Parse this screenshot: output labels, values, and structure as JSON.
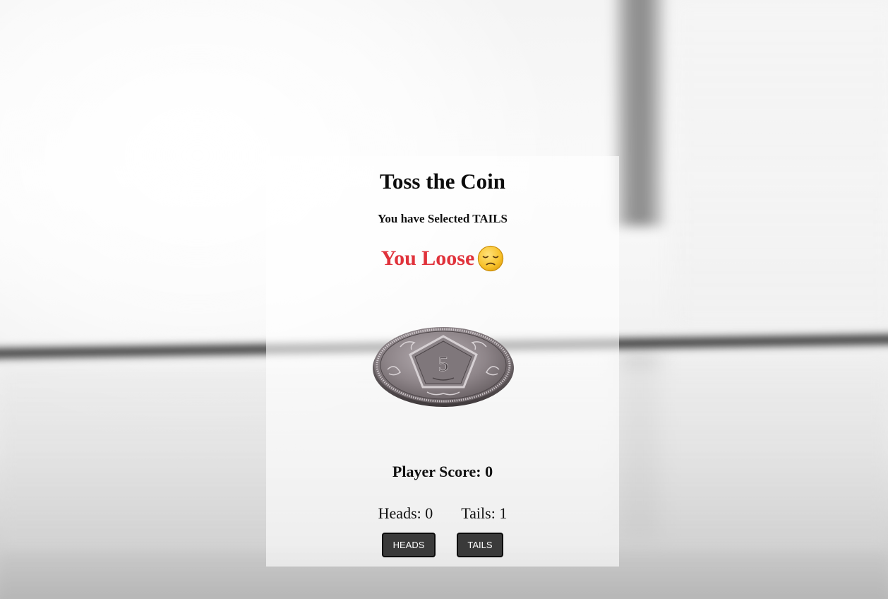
{
  "game": {
    "title": "Toss the Coin",
    "selection_text": "You have Selected TAILS",
    "result_text": "You Loose",
    "result_color": "#e0323b",
    "result_icon": "sad-face-emoji",
    "coin_face": "5",
    "score_text": "Player Score: 0",
    "heads_count_text": "Heads: 0",
    "tails_count_text": "Tails: 1"
  },
  "controls": {
    "heads_label": "HEADS",
    "tails_label": "TAILS",
    "button_color": "#3a3a3a"
  }
}
